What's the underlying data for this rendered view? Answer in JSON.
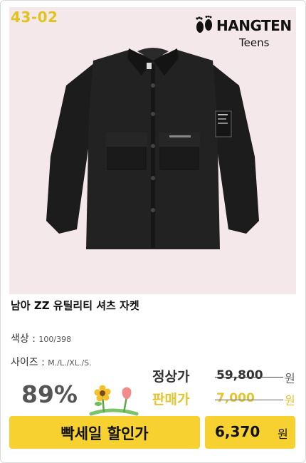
{
  "product": {
    "code": "43-02",
    "brand": "HANGTEN",
    "brand_sub": "Teens",
    "title": "남아 ZZ 유틸리티 셔츠 자켓"
  },
  "options": {
    "color_label": "색상 :",
    "color_value": "100/398",
    "size_label": "사이즈 :",
    "size_value": "M./L./XL./S."
  },
  "pricing": {
    "discount": "89%",
    "regular_label": "정상가",
    "regular_price": "59,800",
    "sale_label": "판매가",
    "sale_price": "7,000",
    "unit": "원"
  },
  "promo": {
    "banner": "빡세일 할인가",
    "final_price": "6,370",
    "unit": "원"
  },
  "colors": {
    "accent": "#f6d12f",
    "photo_bg": "#f4e8ea",
    "code_color": "#e0c41c"
  }
}
